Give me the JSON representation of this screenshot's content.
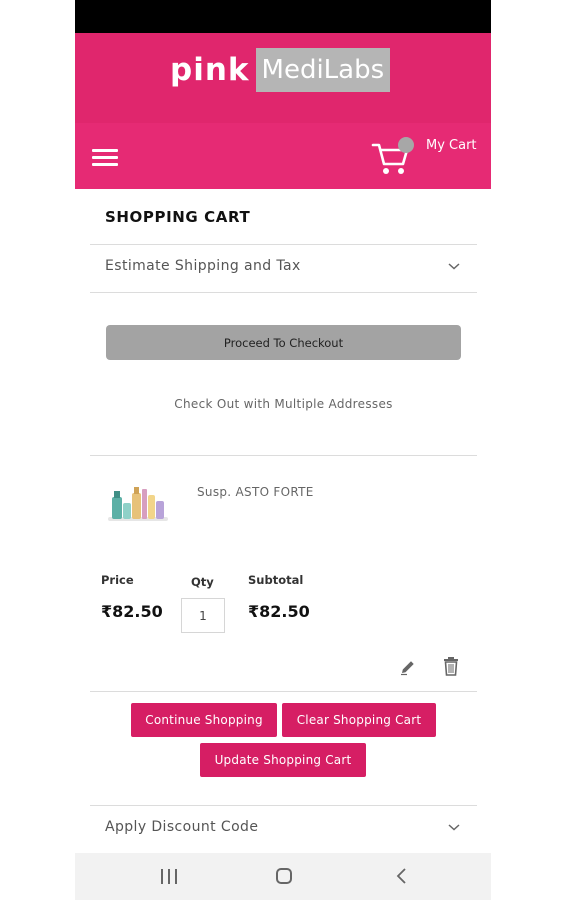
{
  "brand": {
    "part1": "pink",
    "part2": "MediLabs",
    "primary_color": "#e62a74",
    "logo_band_color": "#e0266d"
  },
  "header": {
    "cart_label": "My Cart",
    "cart_icon": "cart-icon",
    "menu_icon": "hamburger-icon"
  },
  "page": {
    "title": "SHOPPING CART",
    "estimate_label": "Estimate Shipping and Tax",
    "checkout_button": "Proceed To Checkout",
    "multi_address_link": "Check Out with Multiple Addresses"
  },
  "item": {
    "name": "Susp. ASTO FORTE",
    "price_label": "Price",
    "qty_label": "Qty",
    "subtotal_label": "Subtotal",
    "price": "₹82.50",
    "qty": "1",
    "subtotal": "₹82.50"
  },
  "actions": {
    "continue": "Continue Shopping",
    "clear": "Clear Shopping Cart",
    "update": "Update Shopping Cart"
  },
  "discount": {
    "label": "Apply Discount Code"
  },
  "system_nav": {
    "recent_icon": "recent-apps-icon",
    "home_icon": "home-icon",
    "back_icon": "back-icon"
  }
}
